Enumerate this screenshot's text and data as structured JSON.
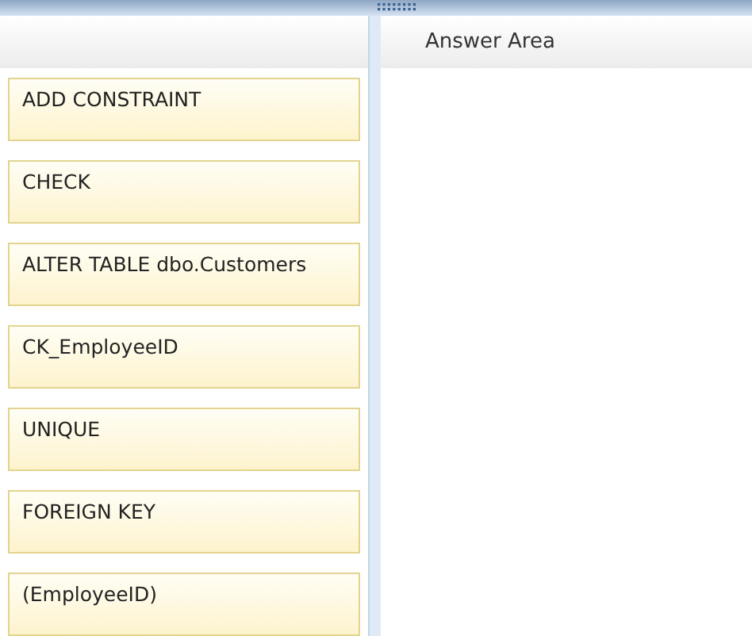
{
  "answer_area": {
    "title": "Answer Area"
  },
  "choices": [
    {
      "label": "ADD CONSTRAINT"
    },
    {
      "label": "CHECK"
    },
    {
      "label": "ALTER TABLE dbo.Customers"
    },
    {
      "label": "CK_EmployeeID"
    },
    {
      "label": "UNIQUE"
    },
    {
      "label": "FOREIGN KEY"
    },
    {
      "label": "(EmployeeID)"
    }
  ]
}
